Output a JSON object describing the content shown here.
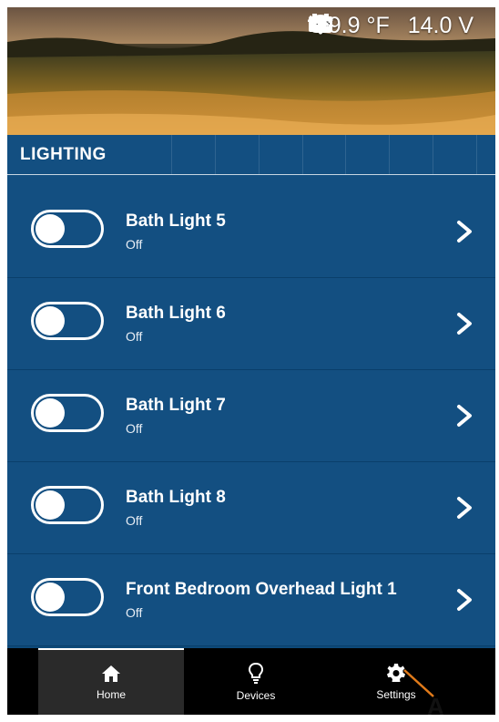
{
  "status_bar": {
    "weather_icon": "cloud-sun-icon",
    "temperature": "99.9 °F",
    "battery_icon": "battery-icon",
    "voltage": "14.0 V",
    "wifi_icon": "wifi-icon"
  },
  "lighting": {
    "section_title": "LIGHTING",
    "items": [
      {
        "name": "Bath Light 5",
        "state": "Off"
      },
      {
        "name": "Bath Light 6",
        "state": "Off"
      },
      {
        "name": "Bath Light 7",
        "state": "Off"
      },
      {
        "name": "Bath Light 8",
        "state": "Off"
      },
      {
        "name": "Front Bedroom Overhead Light 1",
        "state": "Off"
      }
    ]
  },
  "nav": {
    "home": "Home",
    "devices": "Devices",
    "settings": "Settings"
  },
  "annotation": {
    "label": "A"
  },
  "colors": {
    "panel": "#134f81",
    "nav_bg": "#000000",
    "callout": "#e07a1a"
  }
}
